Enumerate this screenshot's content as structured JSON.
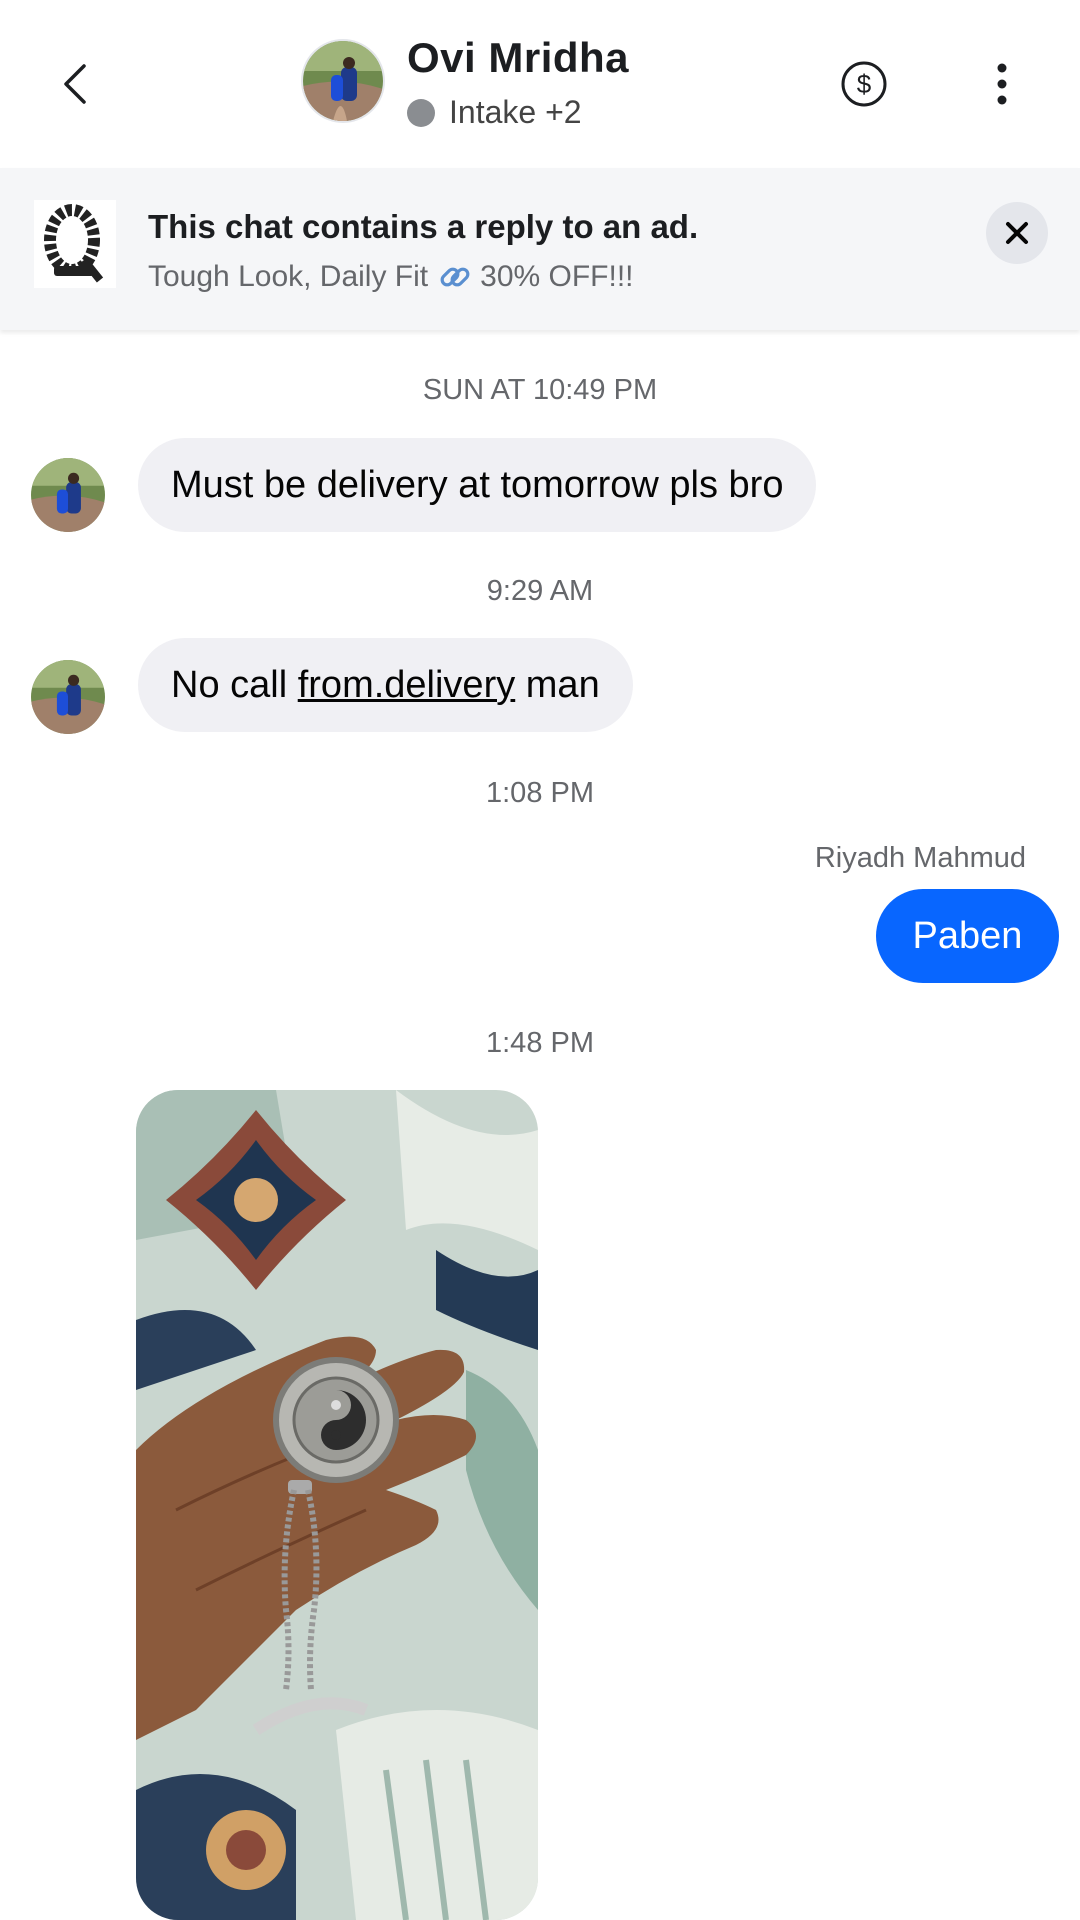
{
  "header": {
    "name": "Ovi Mridha",
    "status_text": "Intake +2",
    "icons": {
      "back": "chevron-left-icon",
      "payment": "dollar-circle-icon",
      "more": "more-vertical-icon"
    }
  },
  "ad_banner": {
    "title": "This chat contains a reply to an ad.",
    "subtitle_left": "Tough Look, Daily Fit",
    "subtitle_right": "30% OFF!!!",
    "icons": {
      "thumbnail": "bracelet-thumbnail",
      "link": "link-emoji-icon",
      "close": "close-icon"
    }
  },
  "messages": [
    {
      "timestamp": "SUN AT 10:49 PM",
      "direction": "incoming",
      "text": "Must be delivery at tomorrow pls bro"
    },
    {
      "timestamp": "9:29 AM",
      "direction": "incoming",
      "text_before": "No call ",
      "text_link": "from.delivery",
      "text_after": " man"
    },
    {
      "timestamp": "1:08 PM",
      "direction": "outgoing",
      "sender": "Riyadh Mahmud",
      "text": "Paben"
    },
    {
      "timestamp": "1:48 PM",
      "direction": "incoming",
      "type": "photo",
      "photo_desc": "hand-holding-yin-yang-pendant-photo"
    }
  ],
  "colors": {
    "outgoing_bubble": "#0866ff",
    "incoming_bubble": "#f0f0f4",
    "banner_bg": "#f5f6f8",
    "status_dot": "#8a8d91"
  }
}
